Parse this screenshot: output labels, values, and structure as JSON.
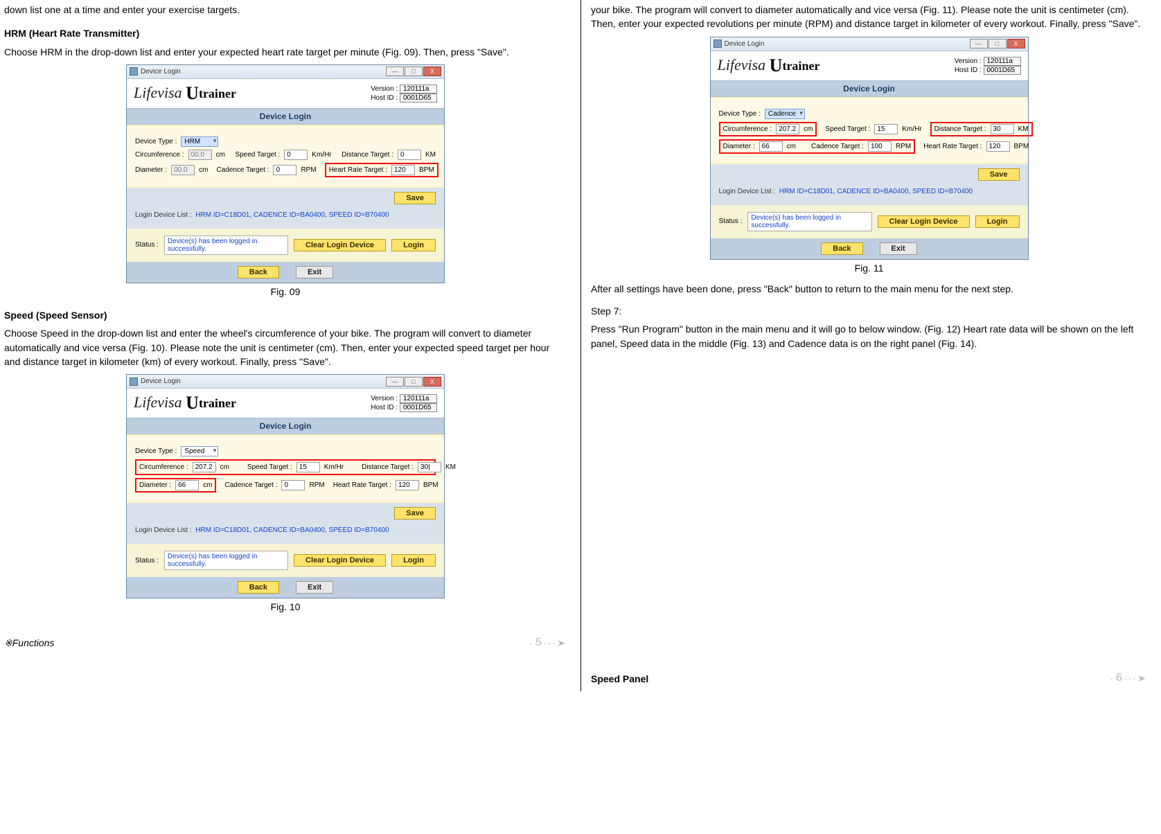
{
  "left": {
    "intro_tail": "down list one at a time and enter your exercise targets.",
    "hrm_h": "HRM (Heart Rate Transmitter)",
    "hrm_p": "Choose HRM in the drop-down list and enter your expected heart rate target per minute (Fig. 09).  Then, press \"Save\".",
    "speed_h": "Speed (Speed Sensor)",
    "speed_p": "Choose Speed in the drop-down list and enter the wheel's circumference of your bike.  The program will convert to diameter automatically and vice versa (Fig. 10).  Please note the unit is centimeter (cm).  Then, enter your expected speed target per hour and distance target in kilometer (km) of every workout.  Finally, press \"Save\".",
    "fig09_cap": "Fig. 09",
    "fig10_cap": "Fig. 10",
    "pgno": "5",
    "footer": "※Functions"
  },
  "right": {
    "intro": "your bike.  The program will convert to diameter automatically and vice versa (Fig. 11).  Please note the unit is centimeter (cm).  Then, enter your expected revolutions per minute (RPM) and distance target in kilometer of every workout.  Finally, press \"Save\".",
    "fig11_cap": "Fig. 11",
    "after_p": "After all settings have been done, press \"Back\" button to return to the main menu for the next step.",
    "step7_h": "Step 7:",
    "step7_p": "Press \"Run Program\" button in the main menu and it will go to below window. (Fig. 12)  Heart rate data will be shown on the left panel, Speed data in the middle  (Fig. 13) and Cadence data is on the right panel  (Fig. 14).",
    "pgno": "6",
    "footer": "Speed Panel"
  },
  "win": {
    "title": "Device Login",
    "min": "—",
    "max": "□",
    "close": "X",
    "logo_a": "Lifevisa ",
    "logo_u": "U",
    "logo_b": "trainer",
    "ver_l": "Version :",
    "ver_v": "120111a",
    "host_l": "Host ID :",
    "host_v": "0001D65",
    "bar": "Device Login",
    "dtype": "Device Type :",
    "circ": "Circumference :",
    "cm": "cm",
    "st": "Speed Target :",
    "kmhr": "Km/Hr",
    "dt": "Distance Target :",
    "km": "KM",
    "diam": "Diameter :",
    "ct": "Cadence Target :",
    "rpm": "RPM",
    "hrt": "Heart Rate Target :",
    "bpm": "BPM",
    "ldl": "Login Device List :",
    "ldl_v": "HRM ID=C18D01, CADENCE ID=BA0400, SPEED ID=B70400",
    "save": "Save",
    "status_l": "Status :",
    "status_v": "Device(s) has been logged in successfully.",
    "clear": "Clear Login Device",
    "login": "Login",
    "back": "Back",
    "exit": "Exit"
  },
  "f09": {
    "dtype_v": "HRM",
    "circ_v": "00.0",
    "st_v": "0",
    "dt_v": "0",
    "diam_v": "00.0",
    "ct_v": "0",
    "hrt_v": "120"
  },
  "f10": {
    "dtype_v": "Speed",
    "circ_v": "207.2",
    "st_v": "15",
    "dt_v": "30|",
    "diam_v": "66",
    "ct_v": "0",
    "hrt_v": "120"
  },
  "f11": {
    "dtype_v": "Cadence",
    "circ_v": "207.2",
    "st_v": "15",
    "dt_v": "30",
    "diam_v": "66",
    "ct_v": "100",
    "hrt_v": "120"
  }
}
